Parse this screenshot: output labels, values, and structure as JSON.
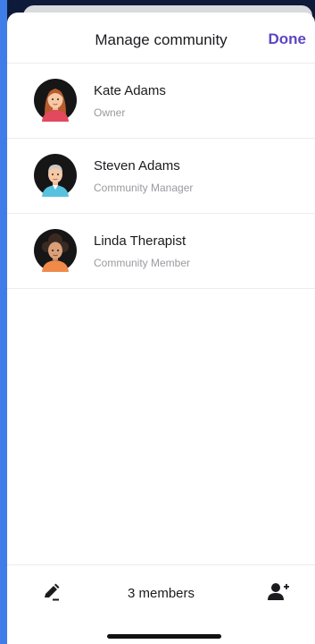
{
  "header": {
    "title": "Manage community",
    "done_label": "Done"
  },
  "members": [
    {
      "name": "Kate Adams",
      "role": "Owner",
      "avatar_icon": "woman-avatar-icon"
    },
    {
      "name": "Steven Adams",
      "role": "Community Manager",
      "avatar_icon": "man-avatar-icon"
    },
    {
      "name": "Linda Therapist",
      "role": "Community Member",
      "avatar_icon": "woman-curly-avatar-icon"
    }
  ],
  "footer": {
    "member_count": "3 members",
    "edit_icon": "pencil-icon",
    "add_icon": "add-user-icon"
  },
  "colors": {
    "accent": "#5d45c4",
    "outer_background": "#3f7ee8"
  }
}
